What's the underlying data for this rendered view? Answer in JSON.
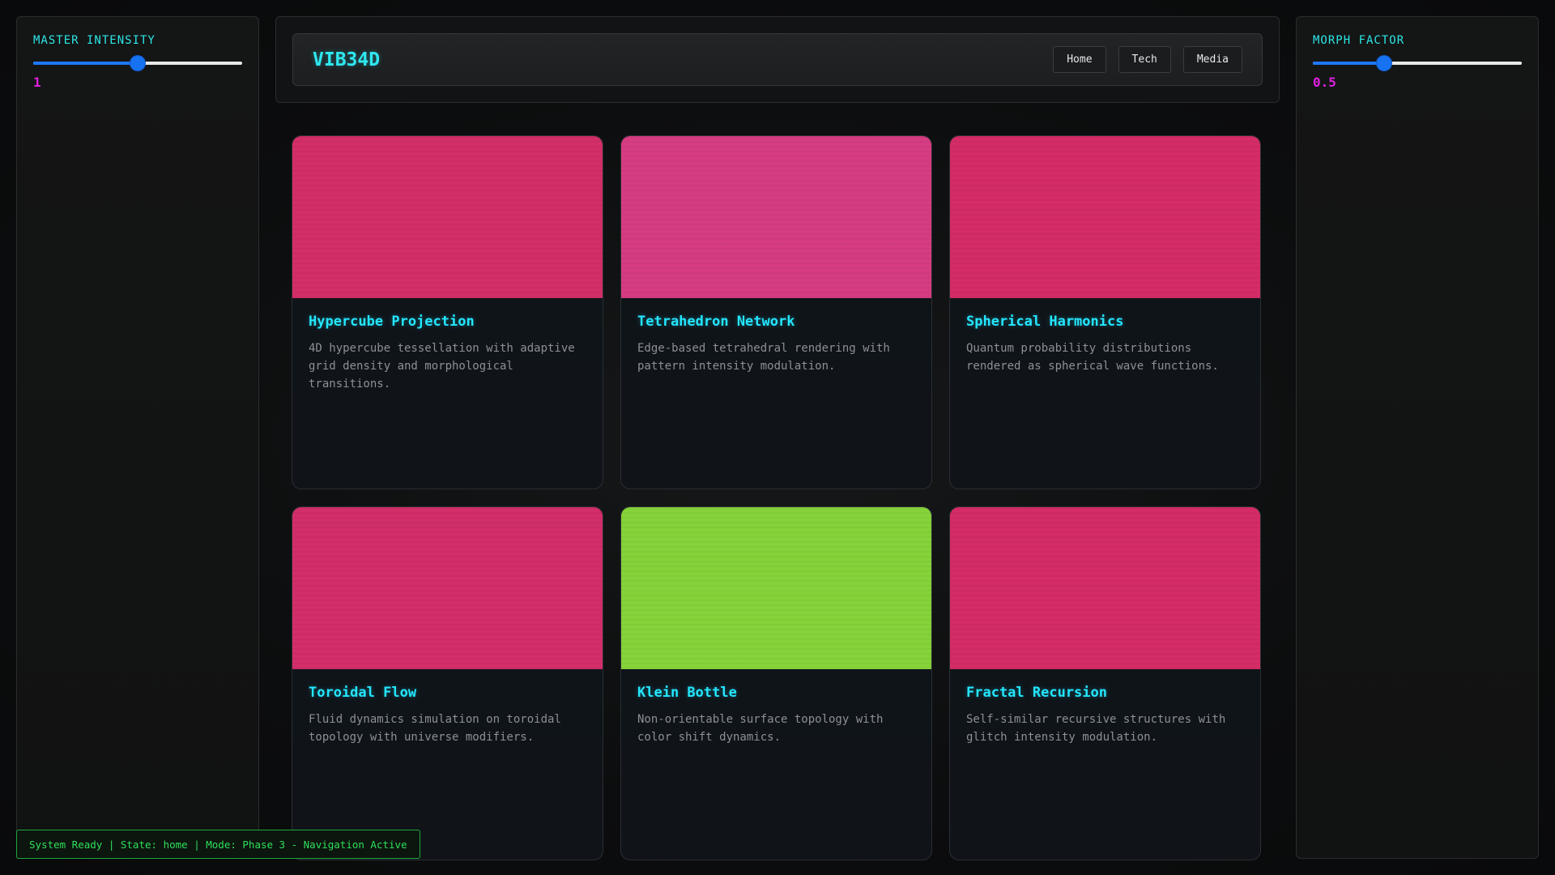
{
  "left_panel": {
    "label": "MASTER INTENSITY",
    "value_display": "1",
    "slider_fraction": 0.5
  },
  "right_panel": {
    "label": "MORPH FACTOR",
    "value_display": "0.5",
    "slider_fraction": 0.34
  },
  "header": {
    "brand": "VIB34D",
    "nav": [
      {
        "label": "Home"
      },
      {
        "label": "Tech"
      },
      {
        "label": "Media"
      }
    ]
  },
  "cards": [
    {
      "title": "Hypercube Projection",
      "description": "4D hypercube tessellation with adaptive grid density and morphological transitions.",
      "color": "#d22e68"
    },
    {
      "title": "Tetrahedron Network",
      "description": "Edge-based tetrahedral rendering with pattern intensity modulation.",
      "color": "#d63c82"
    },
    {
      "title": "Spherical Harmonics",
      "description": "Quantum probability distributions rendered as spherical wave functions.",
      "color": "#d42c66"
    },
    {
      "title": "Toroidal Flow",
      "description": "Fluid dynamics simulation on toroidal topology with universe modifiers.",
      "color": "#d22e6a"
    },
    {
      "title": "Klein Bottle",
      "description": "Non-orientable surface topology with color shift dynamics.",
      "color": "#86d23a"
    },
    {
      "title": "Fractal Recursion",
      "description": "Self-similar recursive structures with glitch intensity modulation.",
      "color": "#d42c66"
    }
  ],
  "status_bar": {
    "text": "System Ready | State: home | Mode: Phase 3 - Navigation Active"
  },
  "colors": {
    "accent_cyan": "#2ee8f0",
    "accent_magenta": "#e020e0",
    "slider_blue": "#1f78ff",
    "status_green": "#2ee05a"
  }
}
